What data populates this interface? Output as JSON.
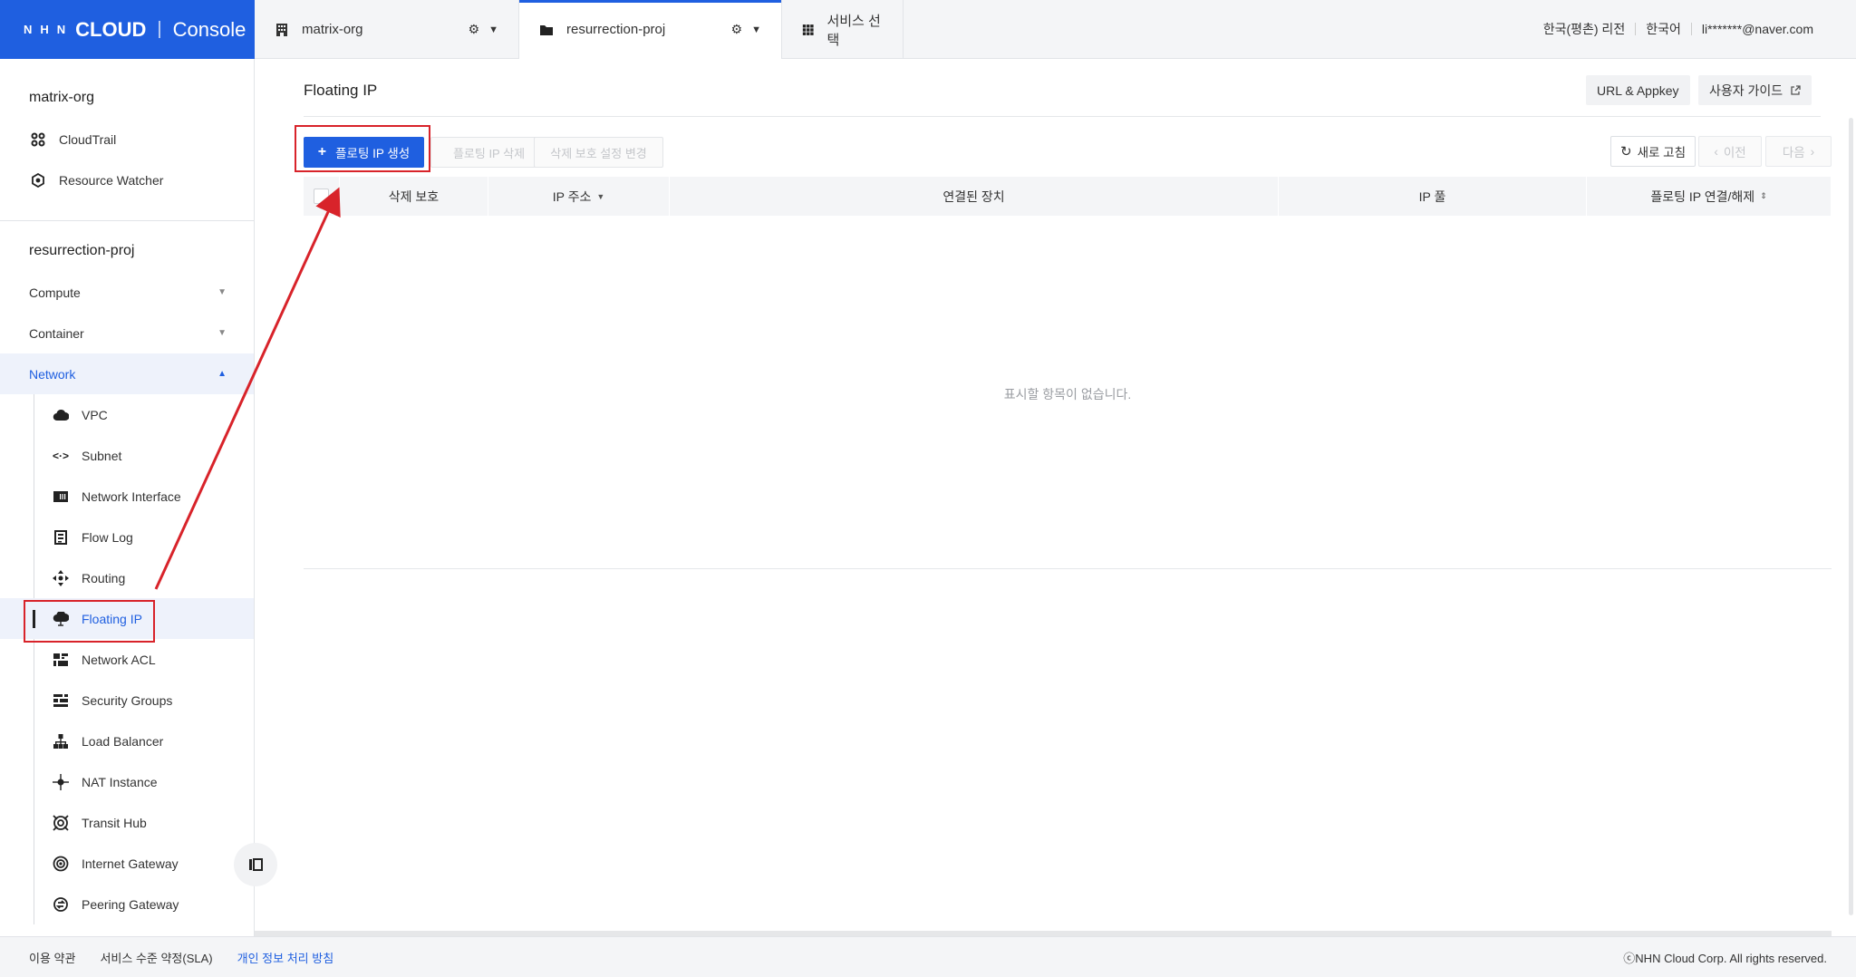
{
  "brand": {
    "nhn": "NHN",
    "cloud": "CLOUD",
    "separator": "|",
    "console": "Console"
  },
  "topbar": {
    "org_tab": "matrix-org",
    "project_tab": "resurrection-proj",
    "service_tab": "서비스 선택",
    "region": "한국(평촌) 리전",
    "language": "한국어",
    "user": "li*******@naver.com"
  },
  "sidebar": {
    "org_title": "matrix-org",
    "org_items": [
      {
        "label": "CloudTrail",
        "icon": "cloudtrail-icon"
      },
      {
        "label": "Resource Watcher",
        "icon": "resource-watcher-icon"
      }
    ],
    "project_title": "resurrection-proj",
    "categories": [
      {
        "label": "Compute"
      },
      {
        "label": "Container"
      },
      {
        "label": "Network"
      }
    ],
    "network_items": [
      {
        "label": "VPC",
        "icon": "cloud-icon"
      },
      {
        "label": "Subnet",
        "icon": "subnet-icon"
      },
      {
        "label": "Network Interface",
        "icon": "network-interface-icon"
      },
      {
        "label": "Flow Log",
        "icon": "flow-log-icon"
      },
      {
        "label": "Routing",
        "icon": "routing-icon"
      },
      {
        "label": "Floating IP",
        "icon": "floating-ip-icon"
      },
      {
        "label": "Network ACL",
        "icon": "network-acl-icon"
      },
      {
        "label": "Security Groups",
        "icon": "security-groups-icon"
      },
      {
        "label": "Load Balancer",
        "icon": "load-balancer-icon"
      },
      {
        "label": "NAT Instance",
        "icon": "nat-instance-icon"
      },
      {
        "label": "Transit Hub",
        "icon": "transit-hub-icon"
      },
      {
        "label": "Internet Gateway",
        "icon": "internet-gateway-icon"
      },
      {
        "label": "Peering Gateway",
        "icon": "peering-gateway-icon"
      }
    ]
  },
  "main": {
    "title": "Floating IP",
    "url_appkey": "URL & Appkey",
    "user_guide": "사용자 가이드",
    "create_button": "플로팅 IP 생성",
    "delete_button": "플로팅 IP 삭제",
    "protect_button": "삭제 보호 설정 변경",
    "refresh_button": "새로 고침",
    "prev_button": "이전",
    "next_button": "다음",
    "columns": [
      "삭제 보호",
      "IP 주소",
      "연결된 장치",
      "IP 풀",
      "플로팅 IP 연결/해제"
    ],
    "empty_message": "표시할 항목이 없습니다."
  },
  "footer": {
    "terms": "이용 약관",
    "sla": "서비스 수준 약정(SLA)",
    "privacy": "개인 정보 처리 방침",
    "copyright": "ⓒNHN Cloud Corp. All rights reserved."
  },
  "colors": {
    "brand": "#1f5fe0",
    "annotation": "#d8232a"
  }
}
